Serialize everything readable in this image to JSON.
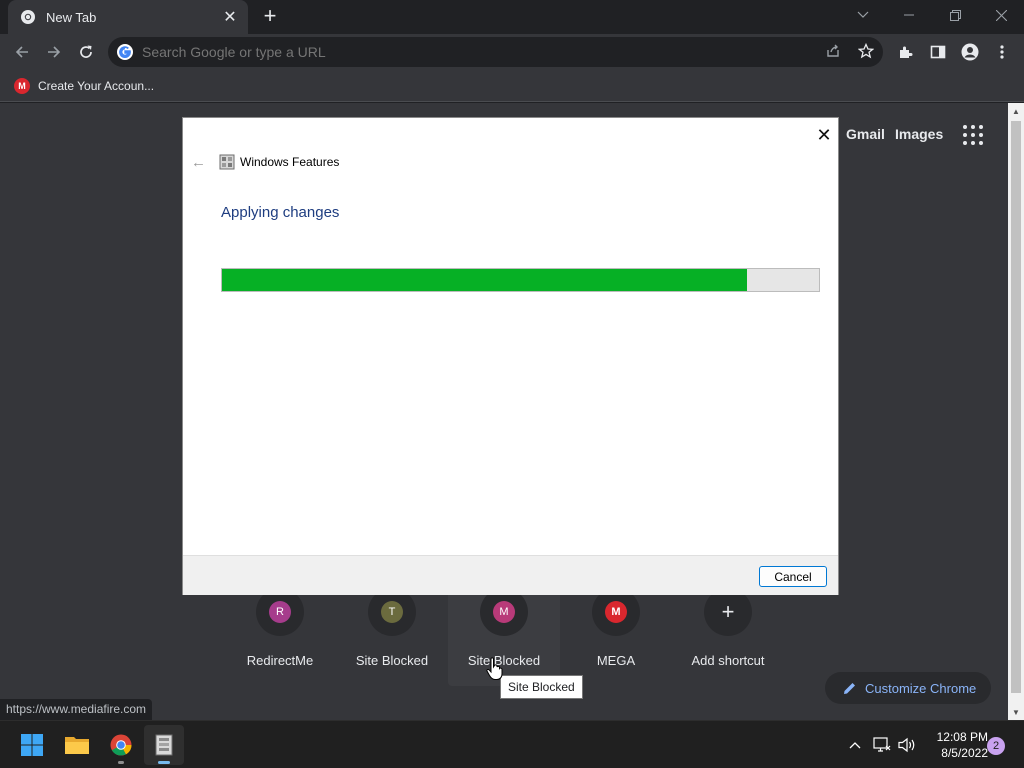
{
  "browser": {
    "tab": {
      "title": "New Tab"
    },
    "omnibox": {
      "placeholder": "Search Google or type a URL"
    },
    "bookmark": {
      "label": "Create Your Accoun...",
      "icon_letter": "M"
    }
  },
  "newtab_page": {
    "top_links": [
      "Gmail",
      "Images"
    ],
    "shortcuts": [
      {
        "label": "RedirectMe",
        "letter": "R",
        "color": "#a63c8c"
      },
      {
        "label": "Site Blocked",
        "letter": "T",
        "color": "#6b6b3e"
      },
      {
        "label": "Site Blocked",
        "letter": "M",
        "color": "#b83a79"
      },
      {
        "label": "MEGA",
        "letter": "M",
        "color": "#d9272e"
      },
      {
        "label": "Add shortcut",
        "letter": "+"
      }
    ],
    "tooltip": "Site Blocked",
    "customize_label": "Customize Chrome",
    "status_url": "https://www.mediafire.com"
  },
  "dialog": {
    "title": "Windows Features",
    "heading": "Applying changes",
    "progress": 0.88,
    "cancel_label": "Cancel"
  },
  "taskbar": {
    "time": "12:08 PM",
    "date": "8/5/2022",
    "notification_count": "2"
  },
  "colors": {
    "progress_fill": "#06b025",
    "heading": "#1e3d80",
    "accent": "#8ab4f8"
  }
}
